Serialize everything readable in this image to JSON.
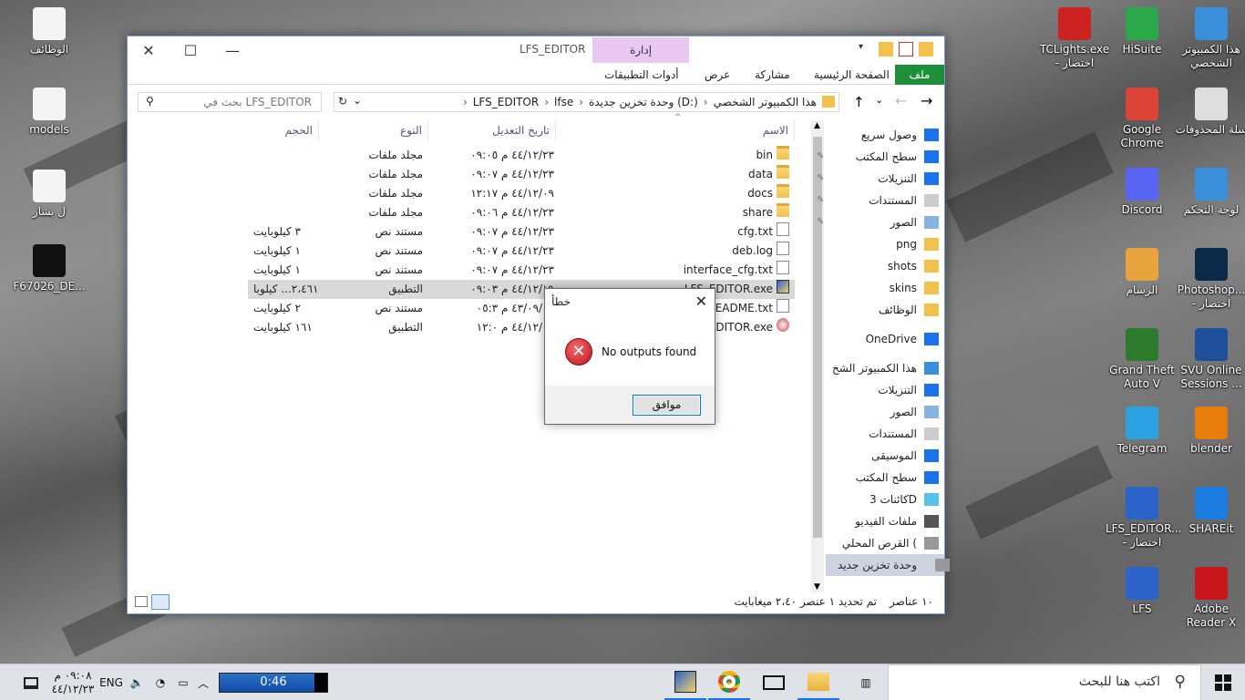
{
  "desktop_left": [
    {
      "label": "الوظائف",
      "icon": "folder-doc-icon"
    },
    {
      "label": "models",
      "icon": "folder-doc-icon"
    },
    {
      "label": "ل بشار",
      "icon": "folder-doc-icon"
    },
    {
      "label": "F67026_DE...",
      "icon": "film-icon"
    }
  ],
  "desktop_right": [
    {
      "label": "هذا الكمبيوتر الشخصي",
      "icon": "computer-icon"
    },
    {
      "label": "HiSuite",
      "icon": "hisuite-icon"
    },
    {
      "label": "TCLights.exe - اختصار",
      "icon": "tclights-icon"
    },
    {
      "label": "سلة المحذوفات",
      "icon": "recycle-bin-icon"
    },
    {
      "label": "Google Chrome",
      "icon": "chrome-icon"
    },
    {
      "label": "لوحة التحكم",
      "icon": "control-panel-icon"
    },
    {
      "label": "Discord",
      "icon": "discord-icon"
    },
    {
      "label": "Photoshop... - اختصار",
      "icon": "photoshop-icon"
    },
    {
      "label": "الرسام",
      "icon": "paint-icon"
    },
    {
      "label": "SVU Online Sessions ...",
      "icon": "svu-icon"
    },
    {
      "label": "Grand Theft Auto V",
      "icon": "gta-icon"
    },
    {
      "label": "blender",
      "icon": "blender-icon"
    },
    {
      "label": "Telegram",
      "icon": "telegram-icon"
    },
    {
      "label": "SHAREit",
      "icon": "shareit-icon"
    },
    {
      "label": "LFS_EDITOR... - اختصار",
      "icon": "lfs-editor-icon"
    },
    {
      "label": "Adobe Reader X",
      "icon": "adobe-reader-icon"
    },
    {
      "label": "LFS",
      "icon": "lfs-icon"
    }
  ],
  "explorer": {
    "title": "LFS_EDITOR",
    "manage_tab": "إدارة",
    "tabs": {
      "file": "ملف",
      "home": "الصفحة الرئيسية",
      "share": "مشاركة",
      "view": "عرض",
      "app_tools": "أدوات التطبيقات"
    },
    "breadcrumb": [
      "هذا الكمبيوتر الشخصي",
      "وحدة تخزين جديدة (D:)",
      "lfse",
      "LFS_EDITOR"
    ],
    "search_placeholder": "بحث في LFS_EDITOR",
    "columns": {
      "name": "الاسم",
      "date": "تاريخ التعديل",
      "type": "النوع",
      "size": "الحجم"
    },
    "files": [
      {
        "name": "bin",
        "date": "٤٤/١٢/٢٣ م ٠٩:٠٥",
        "type": "مجلد ملفات",
        "size": "",
        "icon": "folder-icon"
      },
      {
        "name": "data",
        "date": "٤٤/١٢/٢٣ م ٠٩:٠٧",
        "type": "مجلد ملفات",
        "size": "",
        "icon": "folder-icon"
      },
      {
        "name": "docs",
        "date": "٤٤/١٢/٠٩ م ١٢:١٧",
        "type": "مجلد ملفات",
        "size": "",
        "icon": "folder-icon"
      },
      {
        "name": "share",
        "date": "٤٤/١٢/٢٣ م ٠٩:٠٦",
        "type": "مجلد ملفات",
        "size": "",
        "icon": "folder-icon"
      },
      {
        "name": "cfg.txt",
        "date": "٤٤/١٢/٢٣ م ٠٩:٠٧",
        "type": "مستند نص",
        "size": "٣ كيلوبايت",
        "icon": "text-file-icon"
      },
      {
        "name": "deb.log",
        "date": "٤٤/١٢/٢٣ م ٠٩:٠٧",
        "type": "مستند نص",
        "size": "١ كيلوبايت",
        "icon": "text-file-icon"
      },
      {
        "name": "interface_cfg.txt",
        "date": "٤٤/١٢/٢٣ م ٠٩:٠٧",
        "type": "مستند نص",
        "size": "١ كيلوبايت",
        "icon": "text-file-icon"
      },
      {
        "name": "LFS_EDITOR.exe",
        "date": "٤٤/١٢/١٩ م ٠٩:٠٣",
        "type": "التطبيق",
        "size": "٢،٤٦١... كيلوبا",
        "icon": "exe-icon"
      },
      {
        "name": "README.txt",
        "date": "٤٣/٠٩/٠٧ م ٠٥:٣",
        "type": "مستند نص",
        "size": "٢ كيلوبايت",
        "icon": "text-file-icon"
      },
      {
        "name": "_EDITOR.exe",
        "date": "٤٤/١٢/٠٩ م ١٢:٠",
        "type": "التطبيق",
        "size": "١٦١ كيلوبايت",
        "icon": "exe2-icon"
      }
    ],
    "nav": [
      {
        "label": "وصول سريع",
        "icon": "star-icon",
        "pin": false
      },
      {
        "label": "سطح المكتب",
        "icon": "desktop-icon",
        "pin": true
      },
      {
        "label": "التنزيلات",
        "icon": "download-icon",
        "pin": true
      },
      {
        "label": "المستندات",
        "icon": "documents-icon",
        "pin": true
      },
      {
        "label": "الصور",
        "icon": "pictures-icon",
        "pin": true
      },
      {
        "label": "png",
        "icon": "folder-icon",
        "pin": false
      },
      {
        "label": "shots",
        "icon": "folder-icon",
        "pin": false
      },
      {
        "label": "skins",
        "icon": "folder-icon",
        "pin": false
      },
      {
        "label": "الوظائف",
        "icon": "folder-icon",
        "pin": false
      },
      {
        "label": "OneDrive",
        "icon": "onedrive-icon",
        "pin": false
      },
      {
        "label": "هذا الكمبيوتر الشخ",
        "icon": "computer-icon",
        "pin": false
      },
      {
        "label": "التنزيلات",
        "icon": "download-icon",
        "pin": false
      },
      {
        "label": "الصور",
        "icon": "pictures-icon",
        "pin": false
      },
      {
        "label": "المستندات",
        "icon": "documents-icon",
        "pin": false
      },
      {
        "label": "الموسيقى",
        "icon": "music-icon",
        "pin": false
      },
      {
        "label": "سطح المكتب",
        "icon": "desktop-icon",
        "pin": false
      },
      {
        "label": "كائنات 3D",
        "icon": "3d-objects-icon",
        "pin": false
      },
      {
        "label": "ملفات الفيديو",
        "icon": "video-icon",
        "pin": false
      },
      {
        "label": "القرص المحلي (",
        "icon": "local-disk-icon",
        "pin": false
      },
      {
        "label": "وحدة تخزين جديد",
        "icon": "drive-icon",
        "pin": false
      }
    ],
    "status": {
      "count": "١٠ عناصر",
      "selected": "تم تحديد ١ عنصر ٢،٤٠ ميغابايت"
    }
  },
  "dialog": {
    "title": "خطأ",
    "message": "No outputs found",
    "ok": "موافق"
  },
  "taskbar": {
    "search_placeholder": "اكتب هنا للبحث",
    "media_time": "0:46",
    "lang": "ENG",
    "clock_time": "٠٩:٠٨ م",
    "clock_date": "٤٤/١٢/٢٣"
  },
  "colors": {
    "file_tab": "#1d8f3a",
    "manage_tab": "#e8c8f0",
    "accent": "#0078d7",
    "error": "#c0151b"
  }
}
